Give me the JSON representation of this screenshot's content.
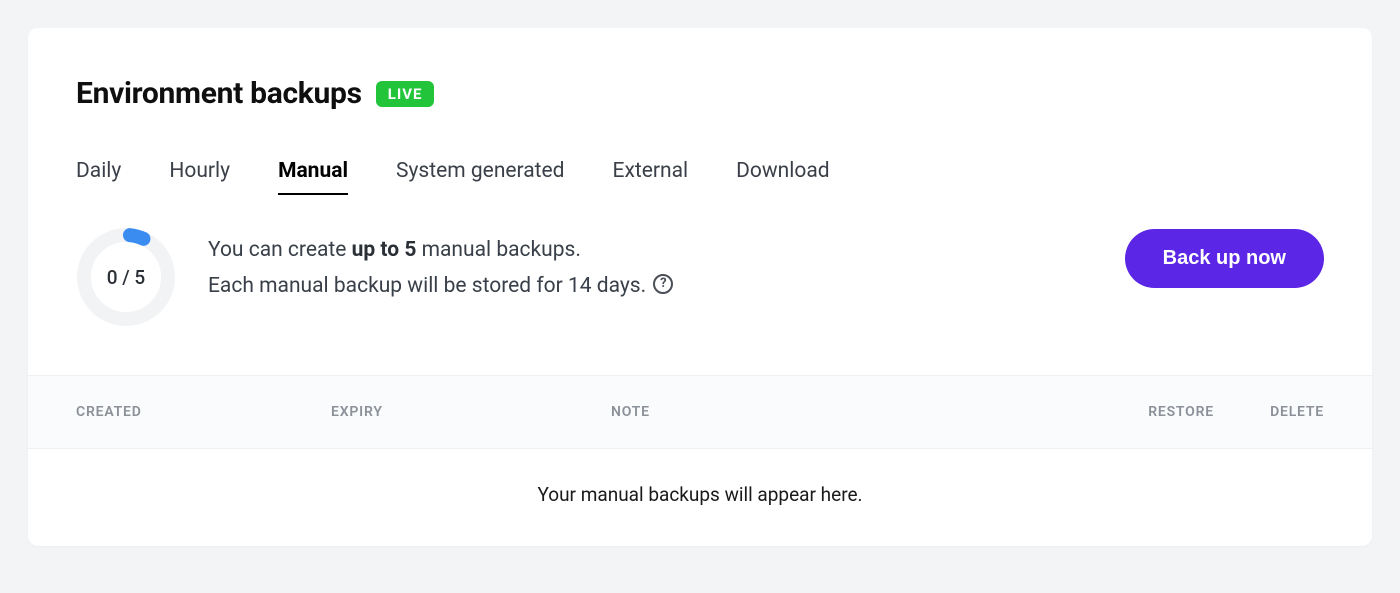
{
  "header": {
    "title": "Environment backups",
    "badge": "LIVE"
  },
  "tabs": [
    {
      "label": "Daily",
      "active": false
    },
    {
      "label": "Hourly",
      "active": false
    },
    {
      "label": "Manual",
      "active": true
    },
    {
      "label": "System generated",
      "active": false
    },
    {
      "label": "External",
      "active": false
    },
    {
      "label": "Download",
      "active": false
    }
  ],
  "usage": {
    "current": 0,
    "max": 5,
    "label": "0 / 5"
  },
  "info": {
    "line1_prefix": "You can create ",
    "line1_strong": "up to 5",
    "line1_suffix": " manual backups.",
    "line2": "Each manual backup will be stored for 14 days. "
  },
  "actions": {
    "backup_button": "Back up now"
  },
  "table": {
    "columns": {
      "created": "CREATED",
      "expiry": "EXPIRY",
      "note": "NOTE",
      "restore": "RESTORE",
      "delete": "DELETE"
    },
    "empty_message": "Your manual backups will appear here."
  }
}
